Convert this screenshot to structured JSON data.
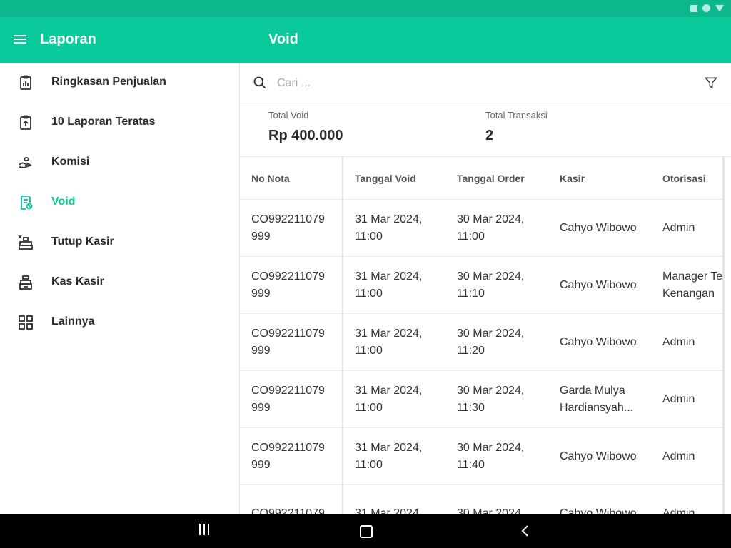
{
  "app": {
    "title": "Laporan",
    "page_title": "Void"
  },
  "sidebar": {
    "items": [
      {
        "label": "Ringkasan Penjualan",
        "icon": "clipboard-chart-icon",
        "active": false
      },
      {
        "label": "10 Laporan Teratas",
        "icon": "clipboard-upload-icon",
        "active": false
      },
      {
        "label": "Komisi",
        "icon": "hand-coin-icon",
        "active": false
      },
      {
        "label": "Void",
        "icon": "receipt-void-icon",
        "active": true
      },
      {
        "label": "Tutup Kasir",
        "icon": "register-close-icon",
        "active": false
      },
      {
        "label": "Kas Kasir",
        "icon": "cash-register-icon",
        "active": false
      },
      {
        "label": "Lainnya",
        "icon": "grid-icon",
        "active": false
      }
    ]
  },
  "search": {
    "placeholder": "Cari ...",
    "value": ""
  },
  "summary": {
    "total_void_label": "Total Void",
    "total_void_value": "Rp 400.000",
    "total_trx_label": "Total Transaksi",
    "total_trx_value": "2"
  },
  "table": {
    "headers": [
      "No Nota",
      "Tanggal Void",
      "Tanggal Order",
      "Kasir",
      "Otorisasi"
    ],
    "rows": [
      [
        "CO992211079 999",
        "31 Mar 2024, 11:00",
        "30 Mar 2024, 11:00",
        "Cahyo Wibowo",
        "Admin"
      ],
      [
        "CO992211079 999",
        "31 Mar 2024, 11:00",
        "30 Mar 2024, 11:10",
        "Cahyo Wibowo",
        "Manager Te Kenangan"
      ],
      [
        "CO992211079 999",
        "31 Mar 2024, 11:00",
        "30 Mar 2024, 11:20",
        "Cahyo Wibowo",
        "Admin"
      ],
      [
        "CO992211079 999",
        "31 Mar 2024, 11:00",
        "30 Mar 2024, 11:30",
        "Garda Mulya Hardiansyah...",
        "Admin"
      ],
      [
        "CO992211079 999",
        "31 Mar 2024, 11:00",
        "30 Mar 2024, 11:40",
        "Cahyo Wibowo",
        "Admin"
      ],
      [
        "CO992211079",
        "31 Mar 2024,",
        "30 Mar 2024,",
        "Cahyo Wibowo",
        "Admin"
      ]
    ]
  },
  "colors": {
    "accent": "#0ac99b",
    "statusbar": "#0db88e"
  }
}
